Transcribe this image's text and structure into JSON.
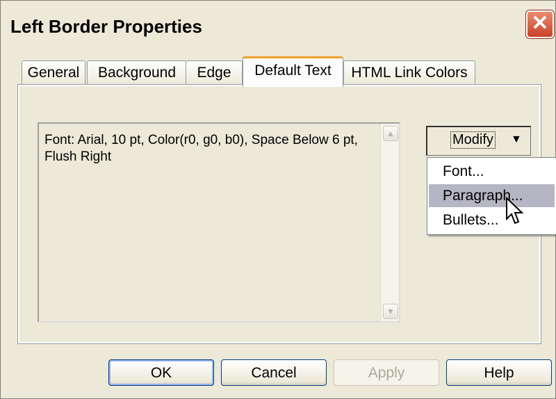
{
  "window": {
    "title": "Left Border Properties",
    "close_glyph": "✕"
  },
  "tabs": [
    {
      "label": "General",
      "active": false
    },
    {
      "label": "Background",
      "active": false
    },
    {
      "label": "Edge",
      "active": false
    },
    {
      "label": "Default Text",
      "active": true
    },
    {
      "label": "HTML Link Colors",
      "active": false
    }
  ],
  "content": {
    "description": "Font:  Arial, 10 pt, Color(r0, g0, b0), Space Below 6 pt, Flush Right"
  },
  "modify": {
    "label": "Modify",
    "arrow": "▼"
  },
  "menu": {
    "items": [
      "Font...",
      "Paragraph...",
      "Bullets..."
    ],
    "hovered_index": 1
  },
  "buttons": {
    "ok": "OK",
    "cancel": "Cancel",
    "apply": "Apply",
    "help": "Help"
  }
}
